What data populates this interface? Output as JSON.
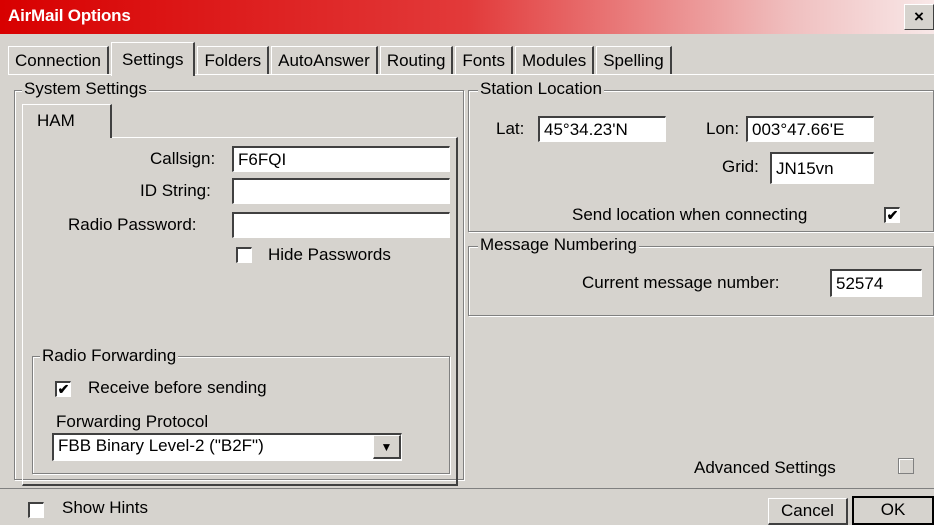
{
  "window": {
    "title": "AirMail Options",
    "close_icon": "×"
  },
  "tabs": [
    {
      "label": "Connection"
    },
    {
      "label": "Settings",
      "active": true
    },
    {
      "label": "Folders"
    },
    {
      "label": "AutoAnswer"
    },
    {
      "label": "Routing"
    },
    {
      "label": "Fonts"
    },
    {
      "label": "Modules"
    },
    {
      "label": "Spelling"
    }
  ],
  "system_settings": {
    "legend": "System Settings",
    "subtab": "HAM",
    "callsign_label": "Callsign:",
    "callsign_value": "F6FQI",
    "id_string_label": "ID String:",
    "id_string_value": "",
    "radio_password_label": "Radio Password:",
    "radio_password_value": "",
    "hide_passwords_label": "Hide Passwords",
    "hide_passwords_checked": false
  },
  "radio_forwarding": {
    "legend": "Radio Forwarding",
    "receive_before_sending_label": "Receive before sending",
    "receive_before_sending_checked": true,
    "protocol_label": "Forwarding Protocol",
    "protocol_value": "FBB Binary Level-2 (\"B2F\")"
  },
  "station_location": {
    "legend": "Station Location",
    "lat_label": "Lat:",
    "lat_value": "45°34.23'N",
    "lon_label": "Lon:",
    "lon_value": "003°47.66'E",
    "grid_label": "Grid:",
    "grid_value": "JN15vn",
    "send_location_label": "Send location when connecting",
    "send_location_checked": true
  },
  "message_numbering": {
    "legend": "Message Numbering",
    "current_label": "Current message number:",
    "current_value": "52574"
  },
  "advanced": {
    "label": "Advanced Settings",
    "checked": false
  },
  "footer": {
    "show_hints_label": "Show Hints",
    "show_hints_checked": false,
    "cancel_label": "Cancel",
    "ok_label": "OK"
  },
  "icons": {
    "checkmark": "✔",
    "dropdown_arrow": "▼"
  }
}
